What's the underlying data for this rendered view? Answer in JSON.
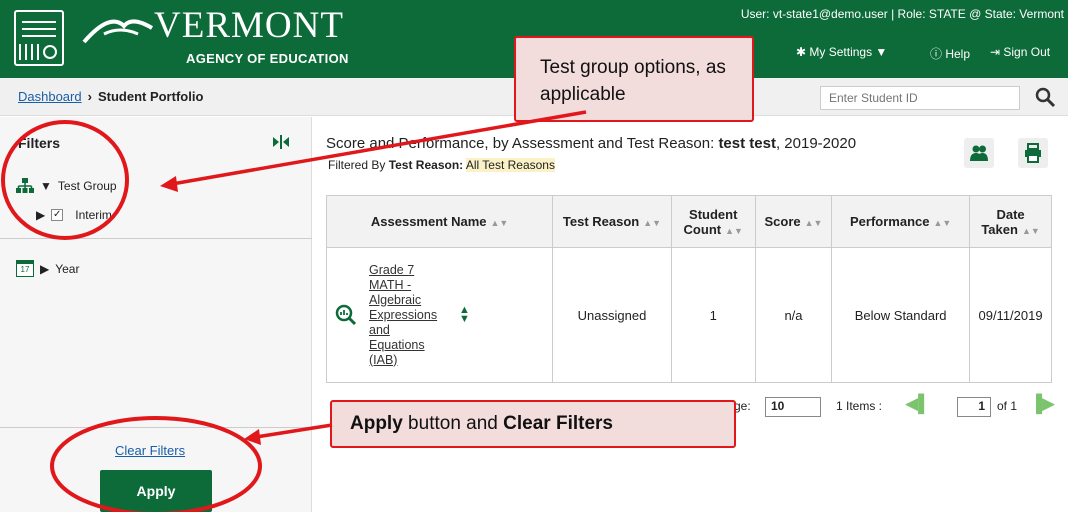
{
  "header": {
    "brand": "VERMONT",
    "agency": "AGENCY OF EDUCATION",
    "user_info": "User: vt-state1@demo.user  |  Role: STATE @ State: Vermont",
    "my_settings": "My Settings ▼",
    "help": "Help",
    "sign_out": "Sign Out"
  },
  "breadcrumb": {
    "dashboard": "Dashboard",
    "separator": "›",
    "current": "Student Portfolio"
  },
  "search": {
    "placeholder": "Enter Student ID",
    "icon": "search-icon"
  },
  "sidebar": {
    "title": "Filters",
    "test_group_label": "Test Group",
    "interim_label": "Interim",
    "interim_checked": "✓",
    "year_label": "Year",
    "calendar_day": "17",
    "clear_filters": "Clear Filters",
    "apply": "Apply"
  },
  "main": {
    "title_prefix": "Score and Performance, by Assessment and Test Reason: ",
    "title_student": "test test",
    "title_year": ", 2019-2020",
    "filter_prefix": "Filtered By ",
    "filter_key": "Test Reason:",
    "filter_value": "All Test Reasons",
    "columns": [
      "Assessment Name",
      "Test Reason",
      "Student Count",
      "Score",
      "Performance",
      "Date Taken"
    ],
    "rows": [
      {
        "assessment": "Grade 7 MATH - Algebraic Expressions and Equations (IAB)",
        "test_reason": "Unassigned",
        "student_count": "1",
        "score": "n/a",
        "performance": "Below Standard",
        "date_taken": "09/11/2019"
      }
    ],
    "pager": {
      "page_size_label": "ge:",
      "page_size": "10",
      "items": "1 Items :",
      "page": "1",
      "of": "of 1"
    }
  },
  "callouts": {
    "test_group": "Test group options, as applicable",
    "apply_bold": "Apply",
    "apply_mid": " button and ",
    "clear_bold": "Clear Filters"
  },
  "colors": {
    "brand_green": "#0d6b3a",
    "callout_border": "#e0181b",
    "callout_fill": "#f2dcdc"
  }
}
